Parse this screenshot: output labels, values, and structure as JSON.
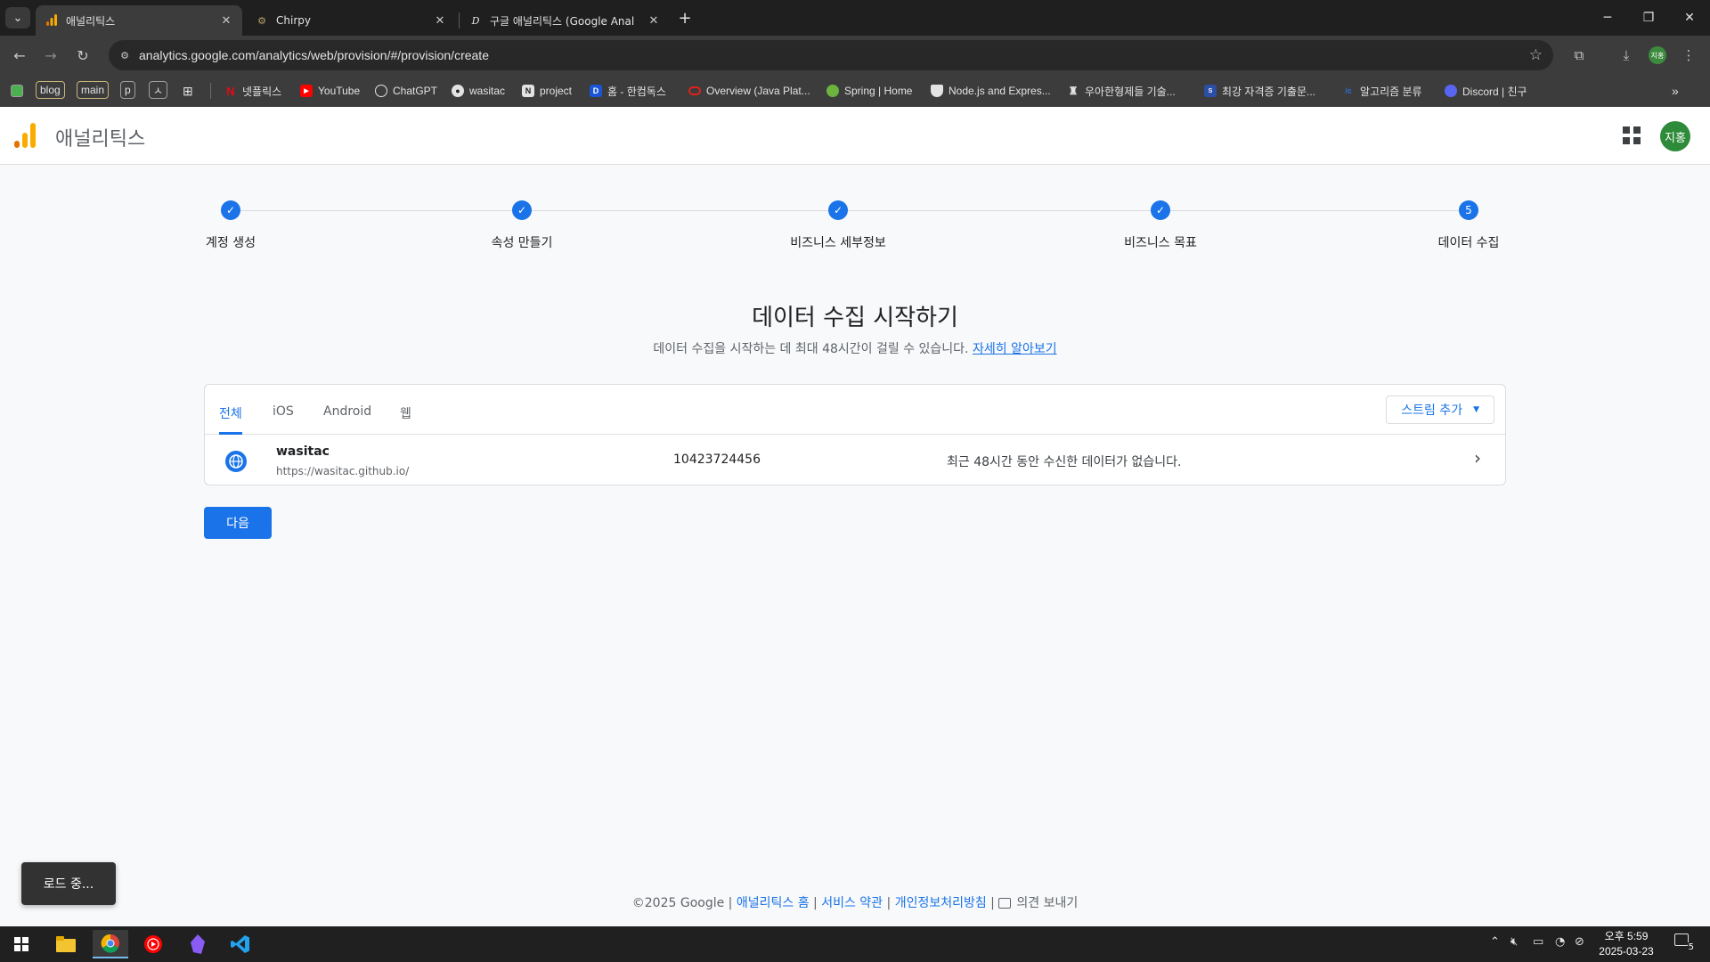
{
  "browser": {
    "tabs": [
      {
        "title": "애널리틱스",
        "active": true,
        "favicon": "analytics-icon"
      },
      {
        "title": "Chirpy",
        "active": false,
        "favicon": "chirpy-icon"
      },
      {
        "title": "구글 애널리틱스 (Google Anal",
        "active": false,
        "favicon": "d-icon"
      }
    ],
    "url": "analytics.google.com/analytics/web/provision/#/provision/create",
    "profile_initials": "지홍"
  },
  "bookmarks": [
    {
      "label": "넷플릭스",
      "icon": "netflix-icon",
      "color": "#e50914"
    },
    {
      "label": "YouTube",
      "icon": "youtube-icon",
      "color": "#ff0000"
    },
    {
      "label": "ChatGPT",
      "icon": "chatgpt-icon",
      "color": "#555555"
    },
    {
      "label": "wasitac",
      "icon": "github-icon",
      "color": "#333333"
    },
    {
      "label": "project",
      "icon": "notion-icon",
      "color": "#444444"
    },
    {
      "label": "홈 - 한컴독스",
      "icon": "hancom-icon",
      "color": "#1a55d9"
    },
    {
      "label": "Overview (Java Plat...",
      "icon": "oracle-icon",
      "color": "#e0201c"
    },
    {
      "label": "Spring | Home",
      "icon": "spring-icon",
      "color": "#6db33f"
    },
    {
      "label": "Node.js and Expres...",
      "icon": "shield-icon",
      "color": "#444444"
    },
    {
      "label": "우아한형제들 기술...",
      "icon": "baemin-icon",
      "color": "#444444"
    },
    {
      "label": "최강 자격증 기출문...",
      "icon": "exam-icon",
      "color": "#2b4fa5"
    },
    {
      "label": "알고리즘 분류",
      "icon": "algo-icon",
      "color": "#2a6fdb"
    },
    {
      "label": "Discord | 친구",
      "icon": "discord-icon",
      "color": "#5865f2"
    }
  ],
  "bookmark_chips": [
    "blog",
    "main",
    "p",
    "ㅅ"
  ],
  "app": {
    "name": "애널리틱스"
  },
  "stepper": {
    "steps": [
      {
        "label": "계정 생성",
        "state": "done"
      },
      {
        "label": "속성 만들기",
        "state": "done"
      },
      {
        "label": "비즈니스 세부정보",
        "state": "done"
      },
      {
        "label": "비즈니스 목표",
        "state": "done"
      },
      {
        "label": "데이터 수집",
        "state": "current",
        "number": "5"
      }
    ]
  },
  "main": {
    "title": "데이터 수집 시작하기",
    "subtitle": "데이터 수집을 시작하는 데 최대 48시간이 걸릴 수 있습니다.",
    "learn_more": "자세히 알아보기"
  },
  "streams": {
    "tabs": [
      "전체",
      "iOS",
      "Android",
      "웹"
    ],
    "active_tab": "전체",
    "add_stream": "스트림 추가",
    "rows": [
      {
        "name": "wasitac",
        "url": "https://wasitac.github.io/",
        "stream_id": "10423724456",
        "status": "최근 48시간 동안 수신한 데이터가 없습니다."
      }
    ]
  },
  "next_button": "다음",
  "footer": {
    "copyright": "©2025 Google",
    "links": [
      "애널리틱스 홈",
      "서비스 약관",
      "개인정보처리방침"
    ],
    "feedback": "의견 보내기"
  },
  "toast": "로드 중...",
  "taskbar": {
    "time": "오후 5:59",
    "date": "2025-03-23",
    "notification_count": "5"
  },
  "colors": {
    "accent": "#1a73e8",
    "avatar": "#2e8b3a"
  }
}
